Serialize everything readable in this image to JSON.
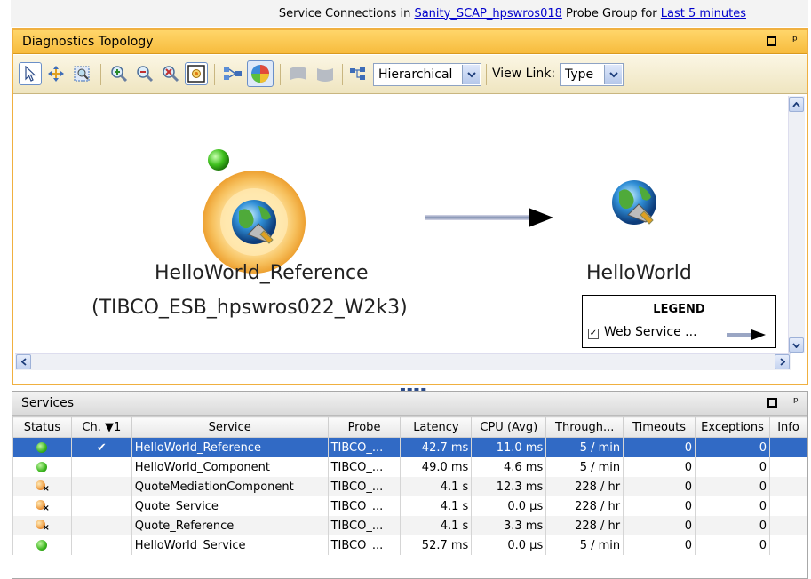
{
  "topbar": {
    "prefix": "Service Connections in ",
    "group_link": "Sanity_SCAP_hpswros018",
    "middle": " Probe Group for ",
    "time_link": "Last 5 minutes"
  },
  "topology": {
    "title": "Diagnostics Topology",
    "toolbar": {
      "icons": [
        "select-arrow-icon",
        "pan-icon",
        "zoom-region-icon",
        "zoom-in-icon",
        "zoom-out-icon",
        "zoom-reset-icon",
        "fit-to-window-icon",
        "show-connections-icon",
        "node-color-icon",
        "collapse-group-icon",
        "expand-group-icon",
        "layout-icon"
      ],
      "layout_value": "Hierarchical",
      "view_link_label": "View Link:",
      "view_link_value": "Type"
    },
    "nodes": [
      {
        "name": "HelloWorld_Reference",
        "subtitle": "(TIBCO_ESB_hpswros022_W2k3)",
        "status": "green",
        "selected": true
      },
      {
        "name": "HelloWorld",
        "subtitle": "",
        "status": "none",
        "selected": false
      }
    ],
    "legend": {
      "title": "LEGEND",
      "item": "Web Service ...",
      "checked": true
    }
  },
  "services": {
    "title": "Services",
    "columns": [
      "Status",
      "Ch. ▼1",
      "Service",
      "Probe",
      "Latency",
      "CPU (Avg)",
      "Through...",
      "Timeouts",
      "Exceptions",
      "Info"
    ],
    "rows": [
      {
        "status": "green",
        "changed": "✔",
        "service": "HelloWorld_Reference",
        "probe": "TIBCO_...",
        "latency": "42.7 ms",
        "cpu": "11.0 ms",
        "throughput": "5 / min",
        "timeouts": "0",
        "exceptions": "0",
        "info": ""
      },
      {
        "status": "green",
        "changed": "",
        "service": "HelloWorld_Component",
        "probe": "TIBCO_...",
        "latency": "49.0 ms",
        "cpu": "4.6 ms",
        "throughput": "5 / min",
        "timeouts": "0",
        "exceptions": "0",
        "info": ""
      },
      {
        "status": "warn",
        "changed": "",
        "service": "QuoteMediationComponent",
        "probe": "TIBCO_...",
        "latency": "4.1 s",
        "cpu": "12.3 ms",
        "throughput": "228 / hr",
        "timeouts": "0",
        "exceptions": "0",
        "info": ""
      },
      {
        "status": "warn",
        "changed": "",
        "service": "Quote_Service",
        "probe": "TIBCO_...",
        "latency": "4.1 s",
        "cpu": "0.0 µs",
        "throughput": "228 / hr",
        "timeouts": "0",
        "exceptions": "0",
        "info": ""
      },
      {
        "status": "warn",
        "changed": "",
        "service": "Quote_Reference",
        "probe": "TIBCO_...",
        "latency": "4.1 s",
        "cpu": "3.3 ms",
        "throughput": "228 / hr",
        "timeouts": "0",
        "exceptions": "0",
        "info": ""
      },
      {
        "status": "green",
        "changed": "",
        "service": "HelloWorld_Service",
        "probe": "TIBCO_...",
        "latency": "52.7 ms",
        "cpu": "0.0 µs",
        "throughput": "5 / min",
        "timeouts": "0",
        "exceptions": "0",
        "info": ""
      }
    ]
  },
  "colors": {
    "header_orange": "#f7bb3d",
    "selection_blue": "#316ac5",
    "status_green": "#3ab51e",
    "status_warn": "#ee9d44"
  }
}
